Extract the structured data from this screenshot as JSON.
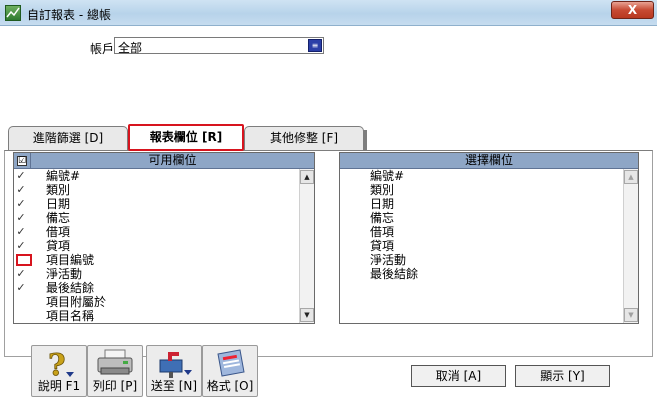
{
  "window": {
    "title": "自訂報表 - 總帳",
    "close_label": "X"
  },
  "account": {
    "label": "帳戶",
    "value": "全部"
  },
  "tabs": [
    {
      "label": "進階篩選 [D]"
    },
    {
      "label": "報表欄位 [R]",
      "selected": true
    },
    {
      "label": "其他修整 [F]"
    }
  ],
  "available_columns": {
    "header": "可用欄位",
    "header_checkbox": "☑",
    "items": [
      {
        "label": "編號#",
        "checked": true
      },
      {
        "label": "類別",
        "checked": true
      },
      {
        "label": "日期",
        "checked": true
      },
      {
        "label": "備忘",
        "checked": true
      },
      {
        "label": "借項",
        "checked": true
      },
      {
        "label": "貸項",
        "checked": true
      },
      {
        "label": "項目編號",
        "checked": false,
        "highlighted": true
      },
      {
        "label": "淨活動",
        "checked": true
      },
      {
        "label": "最後結餘",
        "checked": true
      },
      {
        "label": "項目附屬於",
        "checked": false
      },
      {
        "label": "項目名稱",
        "checked": false
      }
    ],
    "check_glyph": "✓"
  },
  "selected_columns": {
    "header": "選擇欄位",
    "items": [
      "編號#",
      "類別",
      "日期",
      "備忘",
      "借項",
      "貸項",
      "淨活動",
      "最後結餘"
    ]
  },
  "scroll": {
    "up_glyph": "▲",
    "down_glyph": "▼"
  },
  "bottom_buttons": {
    "help": "說明 F1",
    "print": "列印 [P]",
    "send": "送至 [N]",
    "format": "格式 [O]"
  },
  "actions": {
    "cancel": "取消 [A]",
    "show": "顯示 [Y]"
  },
  "colors": {
    "list_header_bg": "#8ea6c6",
    "highlight_red": "#d7141e",
    "titlebar_bg": "#b7d3ea"
  }
}
